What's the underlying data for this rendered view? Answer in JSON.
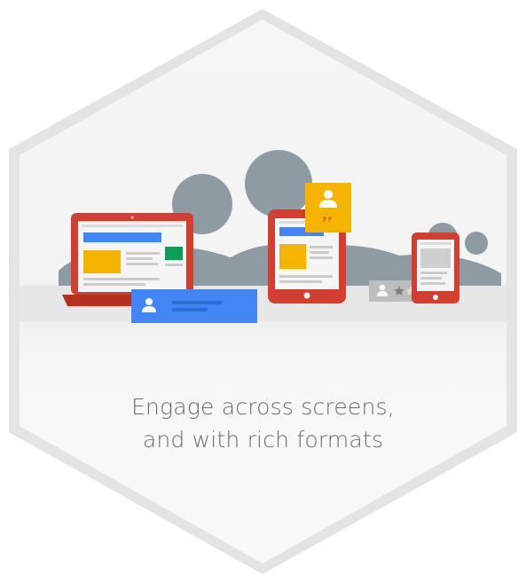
{
  "caption": {
    "line1": "Engage across screens,",
    "line2": "and with rich formats"
  },
  "icons": {
    "profile": "person-icon",
    "quote": "quote-icon",
    "rating": "star-rating-icon"
  },
  "colors": {
    "device_red": "#d23f31",
    "device_red_dark": "#b5301f",
    "google_blue": "#4285f4",
    "google_yellow": "#f4b400",
    "google_green": "#0f9d58",
    "cloud_gray": "#8e9ba3",
    "hex_border": "#e6e6e6",
    "caption_text": "#6b6b6b"
  }
}
